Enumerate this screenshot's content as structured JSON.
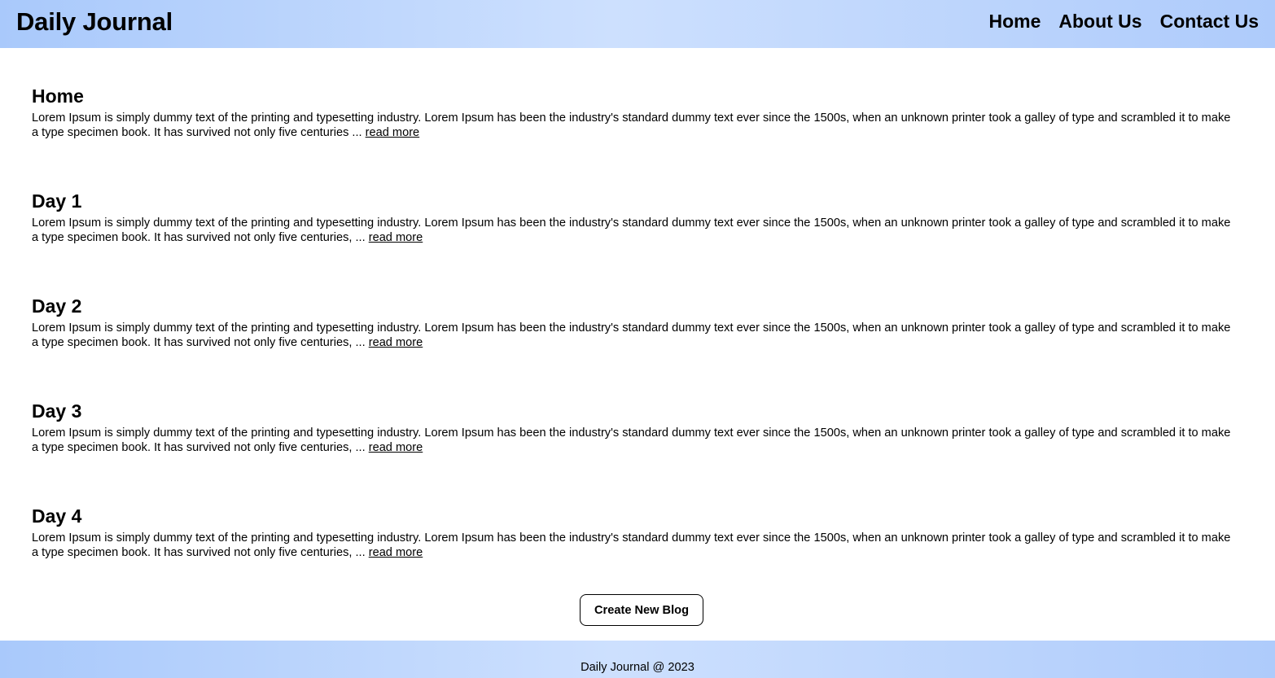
{
  "header": {
    "title": "Daily Journal",
    "nav": [
      "Home",
      "About Us",
      "Contact Us"
    ]
  },
  "posts": [
    {
      "title": "Home",
      "excerpt": "Lorem Ipsum is simply dummy text of the printing and typesetting industry. Lorem Ipsum has been the industry's standard dummy text ever since the 1500s, when an unknown printer took a galley of type and scrambled it to make a type specimen book. It has survived not only five centuries ...",
      "link": "read more"
    },
    {
      "title": "Day 1",
      "excerpt": "Lorem Ipsum is simply dummy text of the printing and typesetting industry. Lorem Ipsum has been the industry's standard dummy text ever since the 1500s, when an unknown printer took a galley of type and scrambled it to make a type specimen book. It has survived not only five centuries, ...",
      "link": "read more"
    },
    {
      "title": "Day 2",
      "excerpt": "Lorem Ipsum is simply dummy text of the printing and typesetting industry. Lorem Ipsum has been the industry's standard dummy text ever since the 1500s, when an unknown printer took a galley of type and scrambled it to make a type specimen book. It has survived not only five centuries, ...",
      "link": "read more"
    },
    {
      "title": "Day 3",
      "excerpt": "Lorem Ipsum is simply dummy text of the printing and typesetting industry. Lorem Ipsum has been the industry's standard dummy text ever since the 1500s, when an unknown printer took a galley of type and scrambled it to make a type specimen book. It has survived not only five centuries, ...",
      "link": "read more"
    },
    {
      "title": "Day 4",
      "excerpt": "Lorem Ipsum is simply dummy text of the printing and typesetting industry. Lorem Ipsum has been the industry's standard dummy text ever since the 1500s, when an unknown printer took a galley of type and scrambled it to make a type specimen book. It has survived not only five centuries, ...",
      "link": "read more"
    }
  ],
  "create_button": "Create New Blog",
  "footer": {
    "text": "Daily Journal @ 2023"
  },
  "colors": {
    "header_gradient_edge": "#a9c9fb",
    "header_gradient_center": "#cde0fe",
    "text": "#000000",
    "background": "#ffffff"
  }
}
